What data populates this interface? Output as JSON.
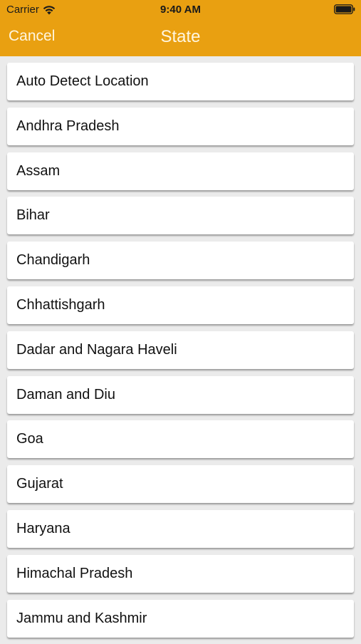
{
  "status_bar": {
    "carrier": "Carrier",
    "time": "9:40 AM"
  },
  "nav": {
    "cancel_label": "Cancel",
    "title": "State"
  },
  "colors": {
    "header": "#e9a011",
    "header_text": "#fff6e0",
    "background": "#ebebeb"
  },
  "items": [
    "Auto Detect Location",
    "Andhra Pradesh",
    "Assam",
    "Bihar",
    "Chandigarh",
    "Chhattishgarh",
    "Dadar and Nagara Haveli",
    "Daman and Diu",
    "Goa",
    "Gujarat",
    "Haryana",
    "Himachal Pradesh",
    "Jammu and Kashmir"
  ]
}
